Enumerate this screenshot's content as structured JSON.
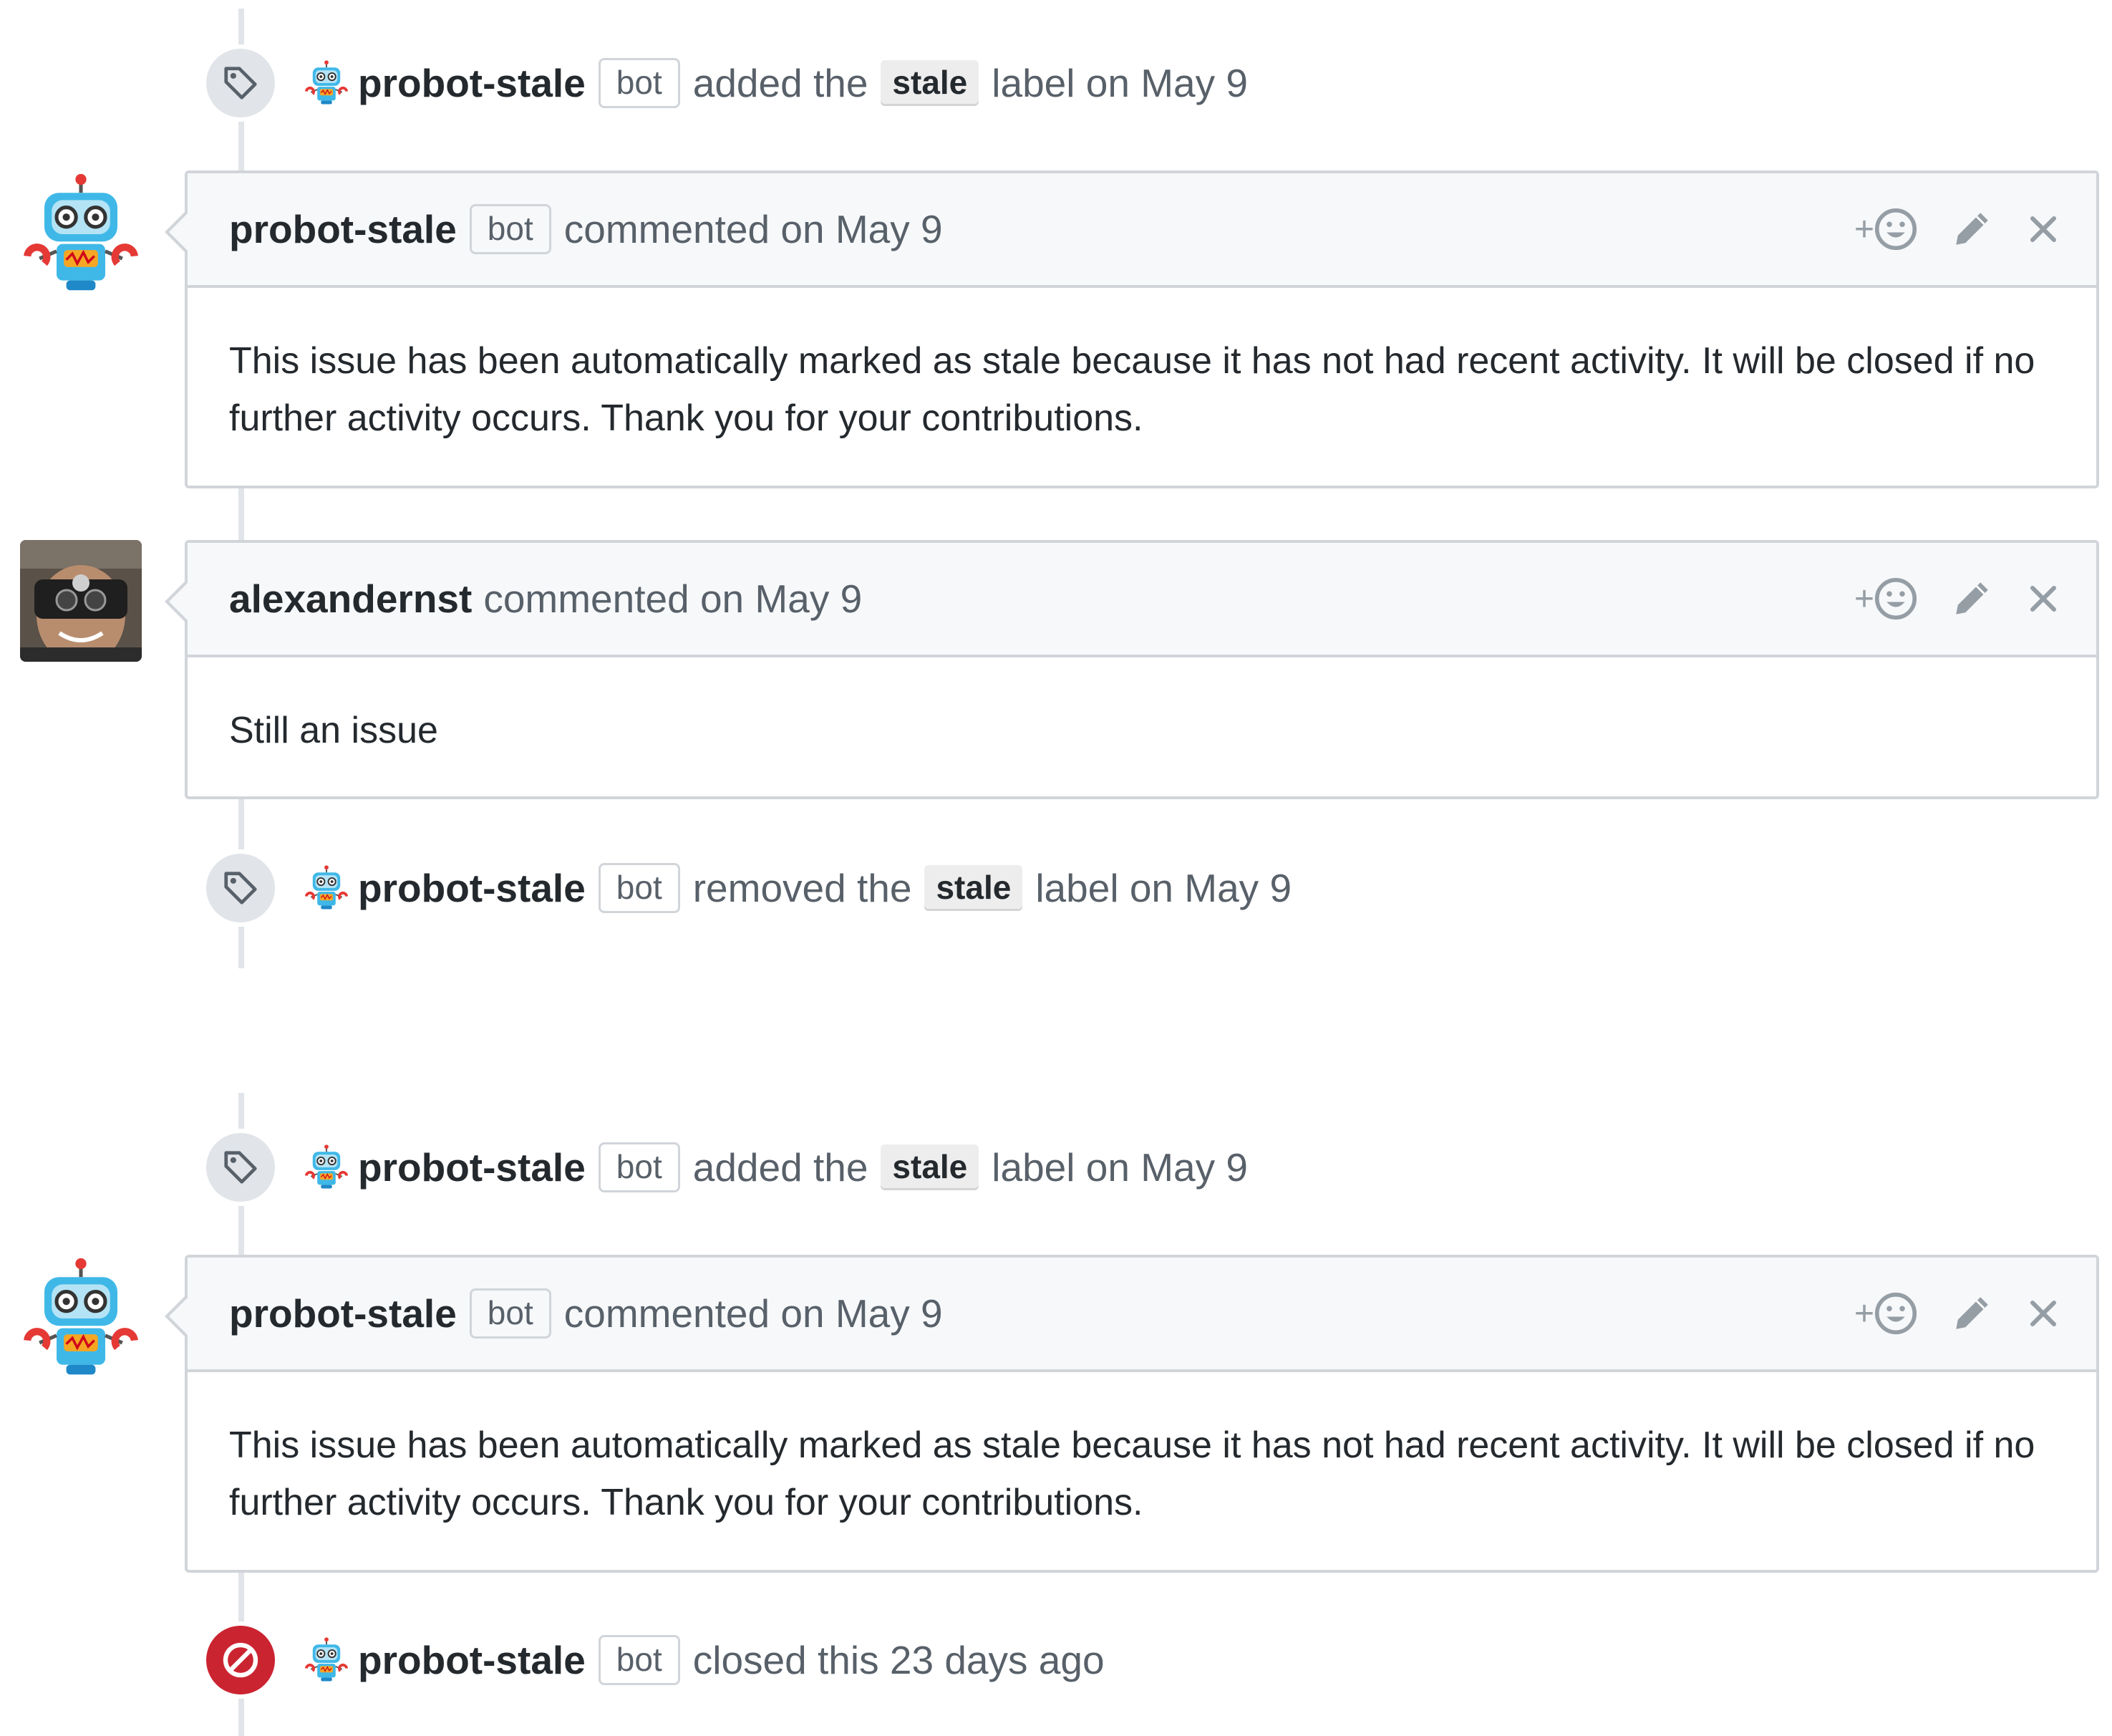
{
  "colors": {
    "closed_badge": "#cb2431",
    "label_bg": "#ededed",
    "header_bg": "#f6f8fa",
    "border": "#d1d5da"
  },
  "timeline": {
    "event1": {
      "actor": "probot-stale",
      "bot": "bot",
      "pre": "added the",
      "label": "stale",
      "post": "label on May 9",
      "icon": "tag-icon"
    },
    "comment1": {
      "author": "probot-stale",
      "bot": "bot",
      "meta": "commented on May 9",
      "react_plus": "+",
      "body": "This issue has been automatically marked as stale because it has not had recent activity. It will be closed if no further activity occurs. Thank you for your contributions."
    },
    "comment2": {
      "author": "alexandernst",
      "meta": "commented on May 9",
      "react_plus": "+",
      "body": "Still an issue"
    },
    "event2": {
      "actor": "probot-stale",
      "bot": "bot",
      "pre": "removed the",
      "label": "stale",
      "post": "label on May 9",
      "icon": "tag-icon"
    },
    "event3": {
      "actor": "probot-stale",
      "bot": "bot",
      "pre": "added the",
      "label": "stale",
      "post": "label on May 9",
      "icon": "tag-icon"
    },
    "comment3": {
      "author": "probot-stale",
      "bot": "bot",
      "meta": "commented on May 9",
      "react_plus": "+",
      "body": "This issue has been automatically marked as stale because it has not had recent activity. It will be closed if no further activity occurs. Thank you for your contributions."
    },
    "event4": {
      "actor": "probot-stale",
      "bot": "bot",
      "text": "closed this 23 days ago",
      "icon": "closed-circle-slash-icon"
    }
  }
}
